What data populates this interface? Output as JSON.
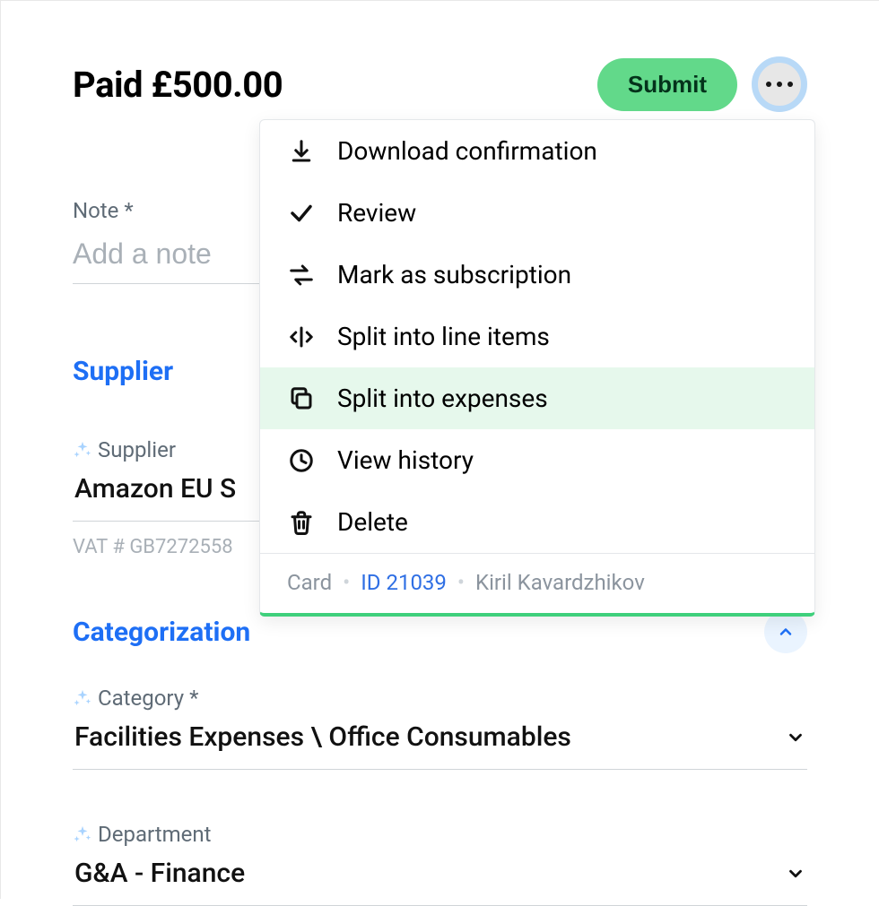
{
  "header": {
    "amount_text": "Paid £500.00",
    "submit_label": "Submit"
  },
  "note": {
    "label": "Note *",
    "placeholder": "Add a note",
    "value": ""
  },
  "supplier_section": {
    "heading": "Supplier",
    "field_label": "Supplier",
    "value": "Amazon EU S",
    "vat_text": "VAT # GB7272558"
  },
  "categorization_section": {
    "heading": "Categorization",
    "category_label": "Category *",
    "category_value": "Facilities Expenses \\ Office Consumables",
    "department_label": "Department",
    "department_value": "G&A - Finance"
  },
  "menu": {
    "items": [
      {
        "icon": "download-icon",
        "label": "Download confirmation"
      },
      {
        "icon": "check-icon",
        "label": "Review"
      },
      {
        "icon": "refresh-icon",
        "label": "Mark as subscription"
      },
      {
        "icon": "split-lines-icon",
        "label": "Split into line items"
      },
      {
        "icon": "copy-icon",
        "label": "Split into expenses",
        "highlight": true
      },
      {
        "icon": "clock-icon",
        "label": "View history"
      },
      {
        "icon": "trash-icon",
        "label": "Delete"
      }
    ],
    "meta": {
      "type": "Card",
      "id_label": "ID 21039",
      "owner": "Kiril Kavardzhikov"
    }
  },
  "colors": {
    "accent_blue": "#1e6ff5",
    "highlight_green": "#e6f8ec",
    "submit_green": "#62d98a"
  }
}
